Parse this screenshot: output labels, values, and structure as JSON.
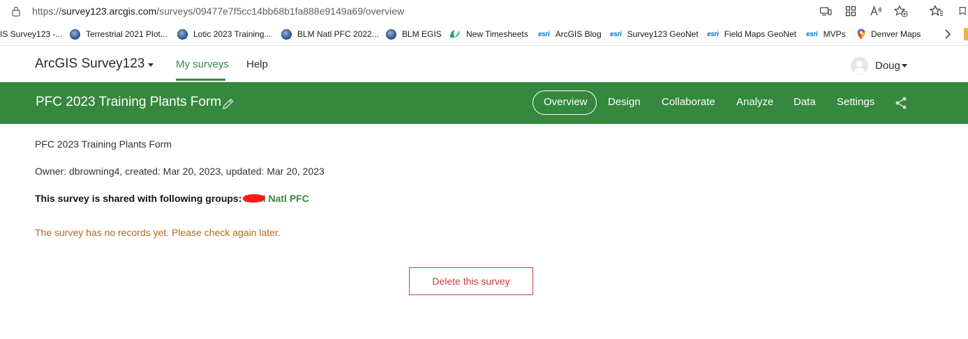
{
  "browser": {
    "url_prefix": "https://",
    "url_host": "survey123.arcgis.com",
    "url_path": "/surveys/09477e7f5cc14bb68b1fa888e9149a69/overview",
    "bookmarks": [
      {
        "label": "IS Survey123 -...",
        "icon": "none"
      },
      {
        "label": "Terrestrial 2021 Plot...",
        "icon": "globe"
      },
      {
        "label": "Lotic 2023 Training...",
        "icon": "globe"
      },
      {
        "label": "BLM Natl PFC 2022...",
        "icon": "globe"
      },
      {
        "label": "BLM EGIS",
        "icon": "globe"
      },
      {
        "label": "New Timesheets",
        "icon": "leaf"
      },
      {
        "label": "ArcGIS Blog",
        "icon": "esri",
        "prefix": "esri"
      },
      {
        "label": "Survey123 GeoNet",
        "icon": "esri",
        "prefix": "esri"
      },
      {
        "label": "Field Maps GeoNet",
        "icon": "esri",
        "prefix": "esri"
      },
      {
        "label": "MVPs",
        "icon": "esri",
        "prefix": "esri"
      },
      {
        "label": "Denver Maps",
        "icon": "map-pin"
      }
    ]
  },
  "header": {
    "brand": "ArcGIS Survey123",
    "nav": [
      {
        "label": "My surveys",
        "active": true
      },
      {
        "label": "Help",
        "active": false
      }
    ],
    "user": "Doug"
  },
  "titlebar": {
    "title": "PFC 2023 Training Plants Form",
    "tabs": [
      {
        "label": "Overview",
        "active": true
      },
      {
        "label": "Design"
      },
      {
        "label": "Collaborate"
      },
      {
        "label": "Analyze"
      },
      {
        "label": "Data"
      },
      {
        "label": "Settings"
      }
    ]
  },
  "content": {
    "survey_name": "PFC 2023 Training Plants Form",
    "owner_line": "Owner: dbrowning4, created: Mar 20, 2023, updated: Mar 20, 2023",
    "shared_label": "This survey is shared with following groups:",
    "group_name": "BLM Natl PFC",
    "no_records": "The survey has no records yet. Please check again later.",
    "delete_label": "Delete this survey"
  },
  "colors": {
    "brand_green": "#35883e",
    "warning": "#b26a1c",
    "danger": "#cc3b3b"
  }
}
